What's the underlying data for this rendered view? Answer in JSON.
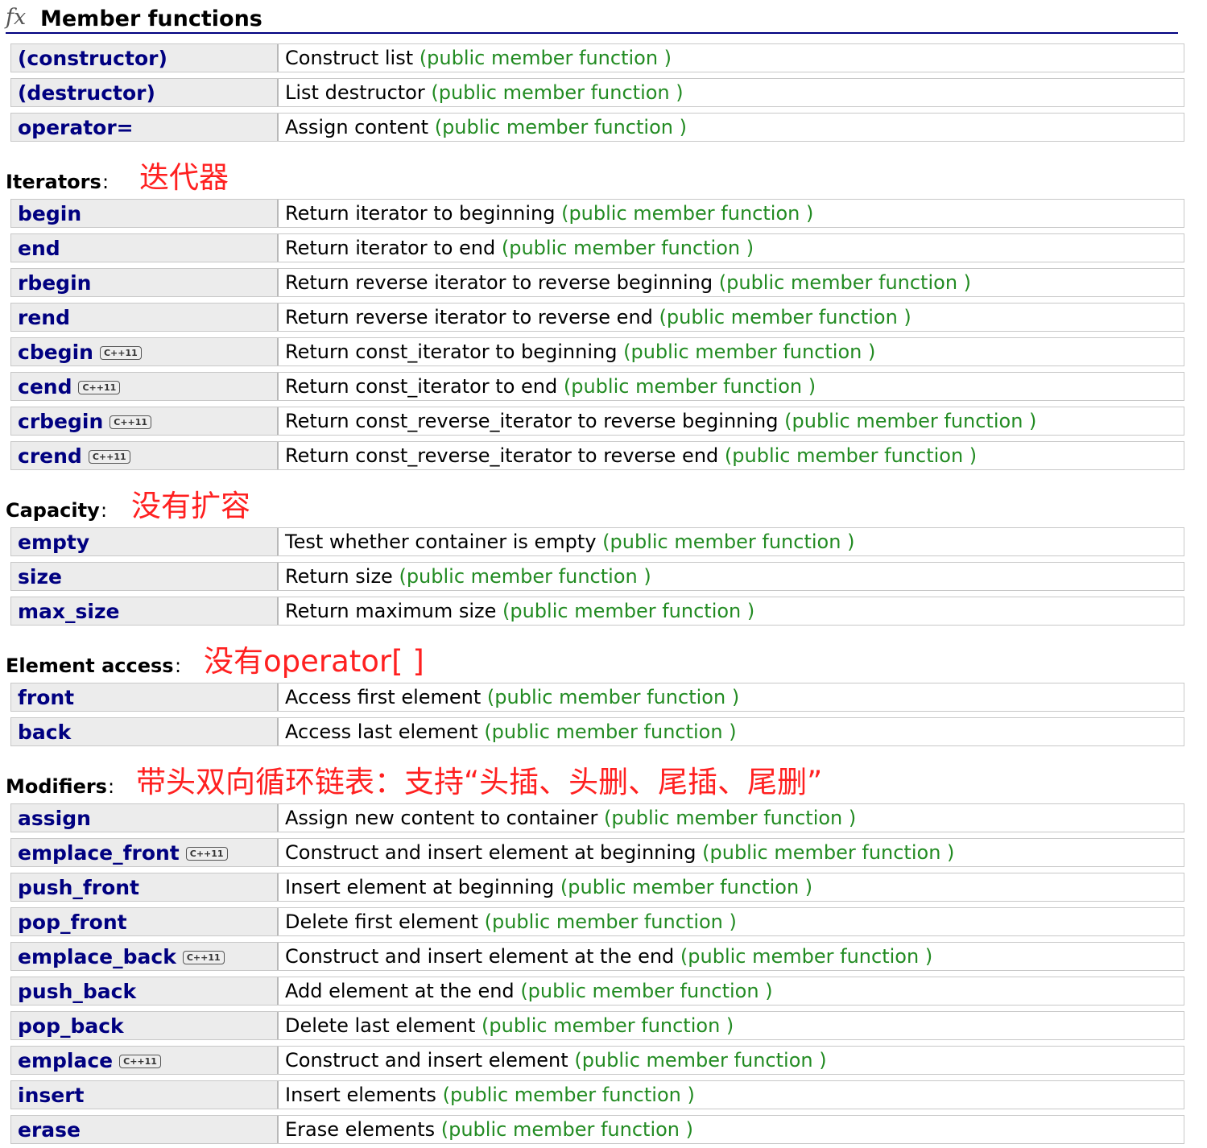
{
  "header": {
    "fx": "fx",
    "title": "Member functions"
  },
  "kind_label": "(public member function )",
  "badge_label": "C++11",
  "sections": [
    {
      "label": "",
      "note": "",
      "rows": [
        {
          "name": "(constructor)",
          "desc": "Construct list",
          "cpp11": false
        },
        {
          "name": "(destructor)",
          "desc": "List destructor",
          "cpp11": false
        },
        {
          "name": "operator=",
          "desc": "Assign content",
          "cpp11": false
        }
      ]
    },
    {
      "label": "Iterators",
      "note": "迭代器",
      "rows": [
        {
          "name": "begin",
          "desc": "Return iterator to beginning",
          "cpp11": false
        },
        {
          "name": "end",
          "desc": "Return iterator to end",
          "cpp11": false
        },
        {
          "name": "rbegin",
          "desc": "Return reverse iterator to reverse beginning",
          "cpp11": false
        },
        {
          "name": "rend",
          "desc": "Return reverse iterator to reverse end",
          "cpp11": false
        },
        {
          "name": "cbegin",
          "desc": "Return const_iterator to beginning",
          "cpp11": true
        },
        {
          "name": "cend",
          "desc": "Return const_iterator to end",
          "cpp11": true
        },
        {
          "name": "crbegin",
          "desc": "Return const_reverse_iterator to reverse beginning",
          "cpp11": true
        },
        {
          "name": "crend",
          "desc": "Return const_reverse_iterator to reverse end",
          "cpp11": true
        }
      ]
    },
    {
      "label": "Capacity",
      "note": "没有扩容",
      "rows": [
        {
          "name": "empty",
          "desc": "Test whether container is empty",
          "cpp11": false
        },
        {
          "name": "size",
          "desc": "Return size",
          "cpp11": false
        },
        {
          "name": "max_size",
          "desc": "Return maximum size",
          "cpp11": false
        }
      ]
    },
    {
      "label": "Element access",
      "note": "没有operator[ ]",
      "rows": [
        {
          "name": "front",
          "desc": "Access first element",
          "cpp11": false
        },
        {
          "name": "back",
          "desc": "Access last element",
          "cpp11": false
        }
      ]
    },
    {
      "label": "Modifiers",
      "note": "带头双向循环链表：支持“头插、头删、尾插、尾删”",
      "rows": [
        {
          "name": "assign",
          "desc": "Assign new content to container",
          "cpp11": false
        },
        {
          "name": "emplace_front",
          "desc": "Construct and insert element at beginning",
          "cpp11": true
        },
        {
          "name": "push_front",
          "desc": "Insert element at beginning",
          "cpp11": false
        },
        {
          "name": "pop_front",
          "desc": "Delete first element",
          "cpp11": false
        },
        {
          "name": "emplace_back",
          "desc": "Construct and insert element at the end",
          "cpp11": true
        },
        {
          "name": "push_back",
          "desc": "Add element at the end",
          "cpp11": false
        },
        {
          "name": "pop_back",
          "desc": "Delete last element",
          "cpp11": false
        },
        {
          "name": "emplace",
          "desc": "Construct and insert element",
          "cpp11": true
        },
        {
          "name": "insert",
          "desc": "Insert elements",
          "cpp11": false
        },
        {
          "name": "erase",
          "desc": "Erase elements",
          "cpp11": false
        }
      ]
    }
  ]
}
